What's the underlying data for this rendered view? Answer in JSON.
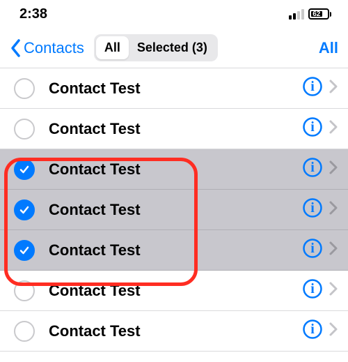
{
  "status": {
    "time": "2:38",
    "battery_pct": "62"
  },
  "nav": {
    "back_label": "Contacts",
    "seg_all": "All",
    "seg_selected": "Selected (3)",
    "right_btn": "All"
  },
  "rows": [
    {
      "name": "Contact Test",
      "selected": false
    },
    {
      "name": "Contact Test",
      "selected": false
    },
    {
      "name": "Contact Test",
      "selected": true
    },
    {
      "name": "Contact Test",
      "selected": true
    },
    {
      "name": "Contact Test",
      "selected": true
    },
    {
      "name": "Contact Test",
      "selected": false
    },
    {
      "name": "Contact Test",
      "selected": false
    }
  ]
}
